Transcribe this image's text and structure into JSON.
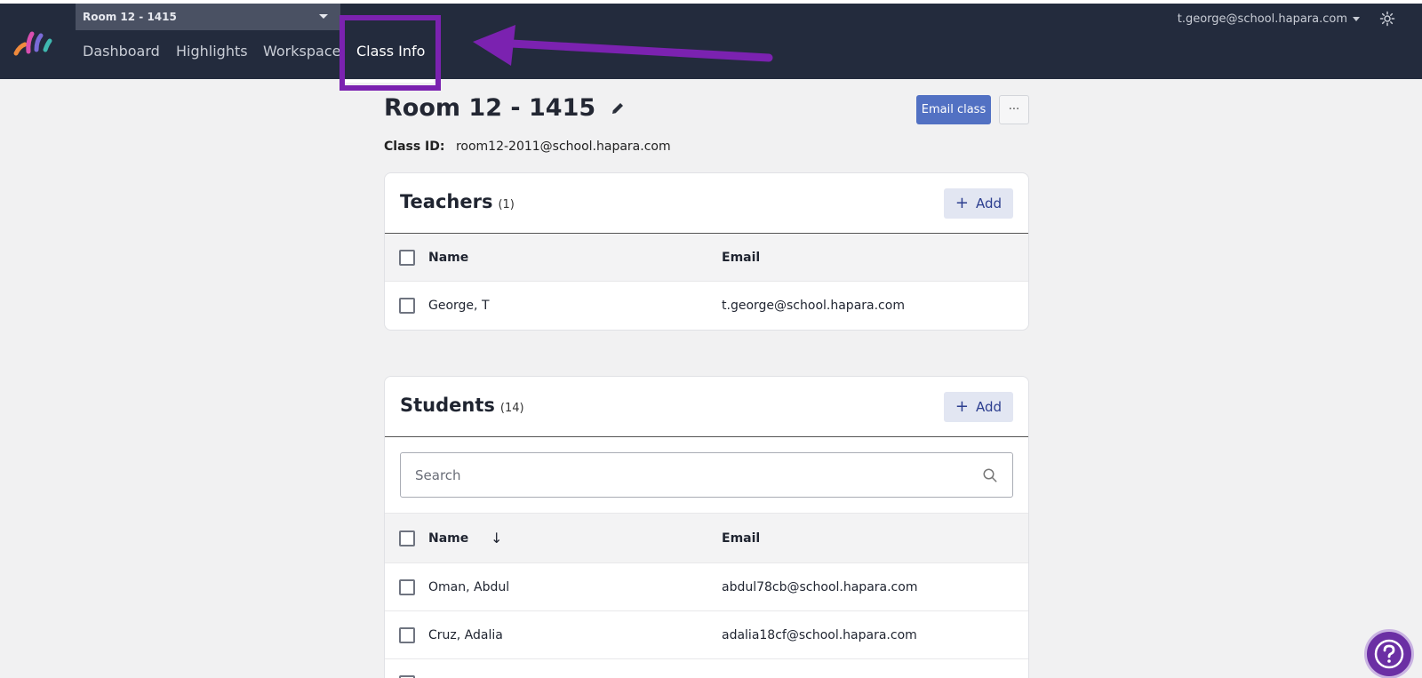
{
  "topbar": {
    "class_select": "Room 12 - 1415",
    "nav": [
      "Dashboard",
      "Highlights",
      "Workspace",
      "Class Info"
    ],
    "user_email": "t.george@school.hapara.com"
  },
  "page": {
    "title": "Room 12 - 1415",
    "email_class_label": "Email class",
    "more_label": "···",
    "class_id_label": "Class ID:",
    "class_id_value": "room12-2011@school.hapara.com"
  },
  "teachers": {
    "title": "Teachers",
    "count": "(1)",
    "add_label": "Add",
    "columns": [
      "Name",
      "Email"
    ],
    "rows": [
      {
        "name": "George, T",
        "email": "t.george@school.hapara.com"
      }
    ]
  },
  "students": {
    "title": "Students",
    "count": "(14)",
    "add_label": "Add",
    "search_placeholder": "Search",
    "columns": [
      "Name",
      "Email"
    ],
    "sort_indicator": "↓",
    "rows": [
      {
        "name": "Oman, Abdul",
        "email": "abdul78cb@school.hapara.com"
      },
      {
        "name": "Cruz, Adalia",
        "email": "adalia18cf@school.hapara.com"
      }
    ]
  },
  "colors": {
    "topbar": "#232b3d",
    "accent": "#5271c3",
    "highlight": "#7b22b0"
  }
}
